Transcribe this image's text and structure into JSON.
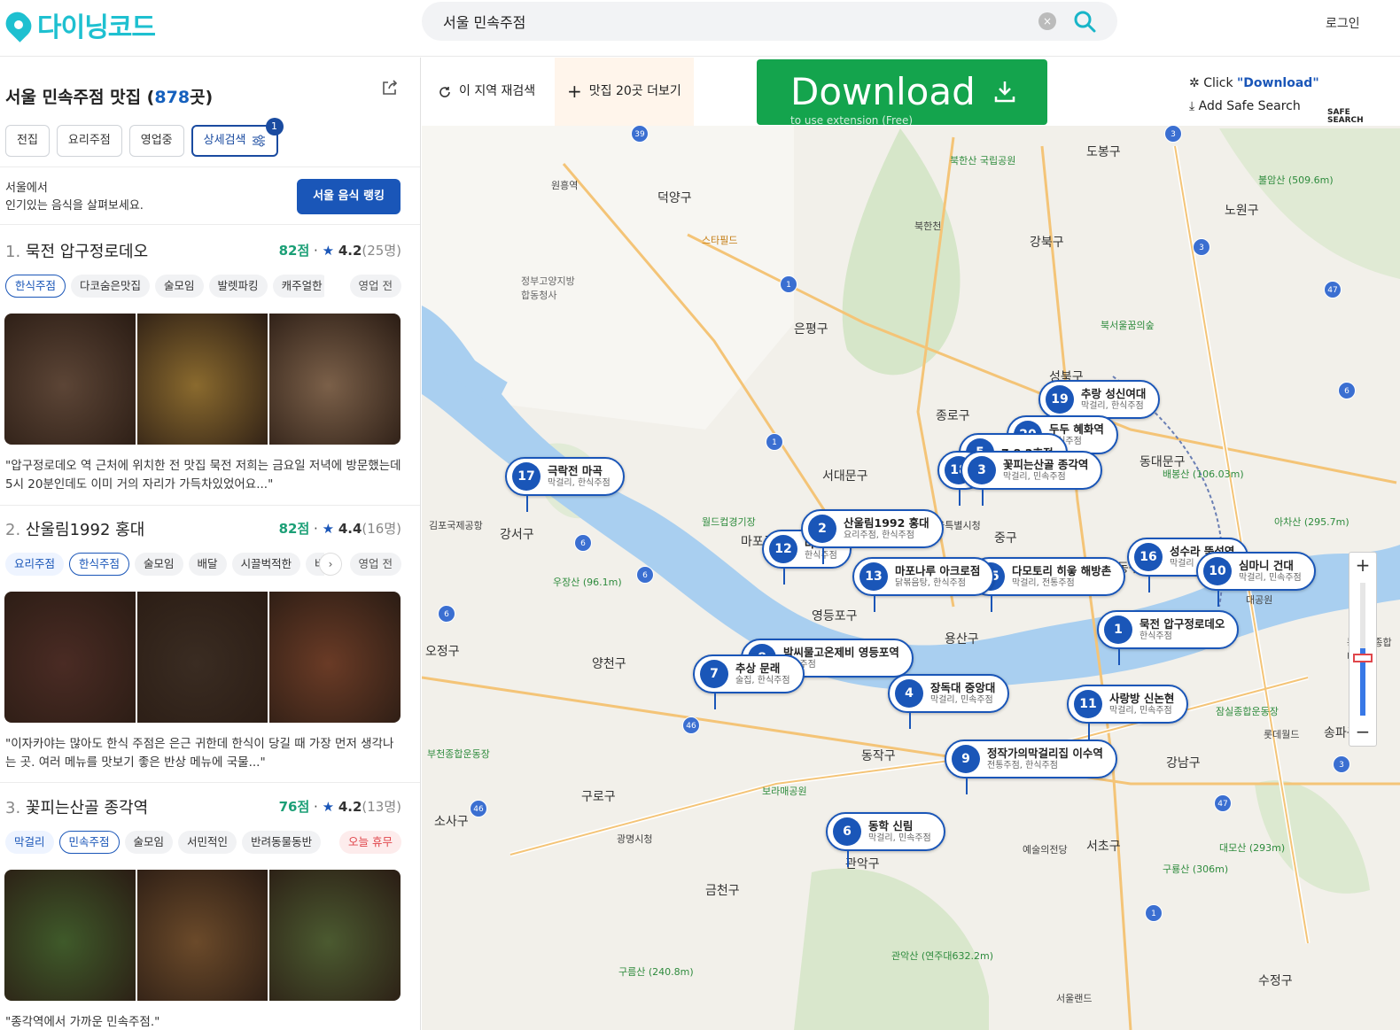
{
  "header": {
    "logo_text": "다이닝코드",
    "search_value": "서울 민속주점",
    "clear_label": "×",
    "login_label": "로그인"
  },
  "sidebar": {
    "title_prefix": "서울 민속주점 맛집 (",
    "title_count": "878",
    "title_suffix": "곳)",
    "filters": [
      "전집",
      "요리주점",
      "영업중",
      "상세검색"
    ],
    "filter_badge": "1",
    "banner_line1": "서울에서",
    "banner_line2": "인기있는 음식을 살펴보세요.",
    "ranking_button": "서울 음식 랭킹"
  },
  "restaurants": [
    {
      "rank": "1.",
      "name": "묵전 압구정로데오",
      "points": "82점",
      "rating": "4.2",
      "reviews": "(25명)",
      "tags": [
        "한식주점",
        "다코숨은맛집",
        "술모임",
        "발렛파킹",
        "캐주얼한"
      ],
      "status": "영업 전",
      "quote": "\"압구정로데오 역 근처에 위치한 전 맛집 묵전 저희는 금요일 저녁에 방문했는데 5시 20분인데도 이미 거의 자리가 가득차있었어요...\"",
      "photo_colors": [
        "#5c4536",
        "#8a6a2e",
        "#7b6049"
      ]
    },
    {
      "rank": "2.",
      "name": "산울림1992 홍대",
      "points": "82점",
      "rating": "4.4",
      "reviews": "(16명)",
      "tags": [
        "요리주점",
        "한식주점",
        "술모임",
        "배달",
        "시끌벅적한",
        "바테"
      ],
      "status": "영업 전",
      "quote": "\"이자카야는 많아도 한식 주점은 은근 귀한데 한식이 당길 때 가장 먼저 생각나는 곳. 여러 메뉴를 맛보기 좋은 반상 메뉴에 국물...\"",
      "photo_colors": [
        "#4a2b24",
        "#3a2c22",
        "#6a3b26"
      ]
    },
    {
      "rank": "3.",
      "name": "꽃피는산골 종각역",
      "points": "76점",
      "rating": "4.2",
      "reviews": "(13명)",
      "tags": [
        "막걸리",
        "민속주점",
        "술모임",
        "서민적인",
        "반려동물동반"
      ],
      "status": "오늘 휴무",
      "quote": "\"종각역에서 가까운 민속주점.\"",
      "photo_colors": [
        "#3f5a2a",
        "#6b4a2a",
        "#4b5a30"
      ]
    }
  ],
  "map": {
    "research_label": "이 지역 재검색",
    "more_label": "맛집 20곳 더보기",
    "download_label": "Download",
    "download_sub": "to use extension (Free)",
    "ext_click": "Click ",
    "ext_click_q": "\"Download\"",
    "ext_add": "Add Safe Search",
    "safe_search_1": "SAFE",
    "safe_search_2": "SEARCH",
    "zoom_in": "+",
    "zoom_out": "−",
    "markers": [
      {
        "num": "19",
        "name": "추랑 성신여대",
        "sub": "막걸리, 한식주점"
      },
      {
        "num": "20",
        "name": "두두 혜화역",
        "sub": "한식주점"
      },
      {
        "num": "5",
        "name": "7.8.2호점",
        "sub": ""
      },
      {
        "num": "3",
        "name": "꽃피는산골 종각역",
        "sub": "막걸리, 민속주점"
      },
      {
        "num": "17",
        "name": "극락전 마곡",
        "sub": "막걸리, 한식주점"
      },
      {
        "num": "2",
        "name": "산울림1992 홍대",
        "sub": "요리주점, 한식주점"
      },
      {
        "num": "12",
        "name": "다",
        "sub": "한식주점"
      },
      {
        "num": "13",
        "name": "마포나루 아크로점",
        "sub": "닭볶음탕, 한식주점"
      },
      {
        "num": "15",
        "name": "다모토리 히읗 해방촌",
        "sub": "막걸리, 전통주점"
      },
      {
        "num": "16",
        "name": "성수라 뚝섬역",
        "sub": "막걸리"
      },
      {
        "num": "10",
        "name": "심마니 건대",
        "sub": "막걸리, 민속주점"
      },
      {
        "num": "1",
        "name": "묵전 압구정로데오",
        "sub": "한식주점"
      },
      {
        "num": "8",
        "name": "박씨물고온제비 영등포역",
        "sub": "민속주점"
      },
      {
        "num": "7",
        "name": "추상 문래",
        "sub": "술집, 한식주점"
      },
      {
        "num": "4",
        "name": "장독대 중앙대",
        "sub": "막걸리, 민속주점"
      },
      {
        "num": "11",
        "name": "사랑방 신논현",
        "sub": "막걸리, 민속주점"
      },
      {
        "num": "9",
        "name": "정작가의막걸리집 이수역",
        "sub": "전통주점, 한식주점"
      },
      {
        "num": "6",
        "name": "동학 신림",
        "sub": "막걸리, 민속주점"
      },
      {
        "num": "18",
        "name": "",
        "sub": ""
      }
    ],
    "districts": [
      "도봉구",
      "덕양구",
      "노원구",
      "강북구",
      "은평구",
      "성북구",
      "종로구",
      "서대문구",
      "동대문구",
      "중구",
      "마포구",
      "강서구",
      "용산구",
      "성동구",
      "양천구",
      "오정구",
      "영등포구",
      "동작구",
      "구로구",
      "소사구",
      "관악구",
      "서초구",
      "강남구",
      "금천구",
      "송파구",
      "수정구"
    ],
    "mountains": [
      "북한산 국립공원",
      "불암산 (509.6m)",
      "북서울꿈의숲",
      "배봉산 (106.03m)",
      "아차산 (295.7m)",
      "우장산 (96.1m)",
      "관악산 (연주대632.2m)",
      "구룡산 (306m)",
      "대모산 (293m)",
      "구름산 (240.8m)",
      "보라매공원"
    ],
    "places": [
      "김포국제공항",
      "스타필드",
      "월드컵경기장",
      "서울특별시청",
      "롯데월드",
      "예술의전당",
      "서울랜드",
      "잠실종합운동장",
      "부천종합운동장",
      "광명시청",
      "동서울종합터미널",
      "원흥역",
      "대공원",
      "북한천",
      "정부고양지방합동청사"
    ]
  }
}
